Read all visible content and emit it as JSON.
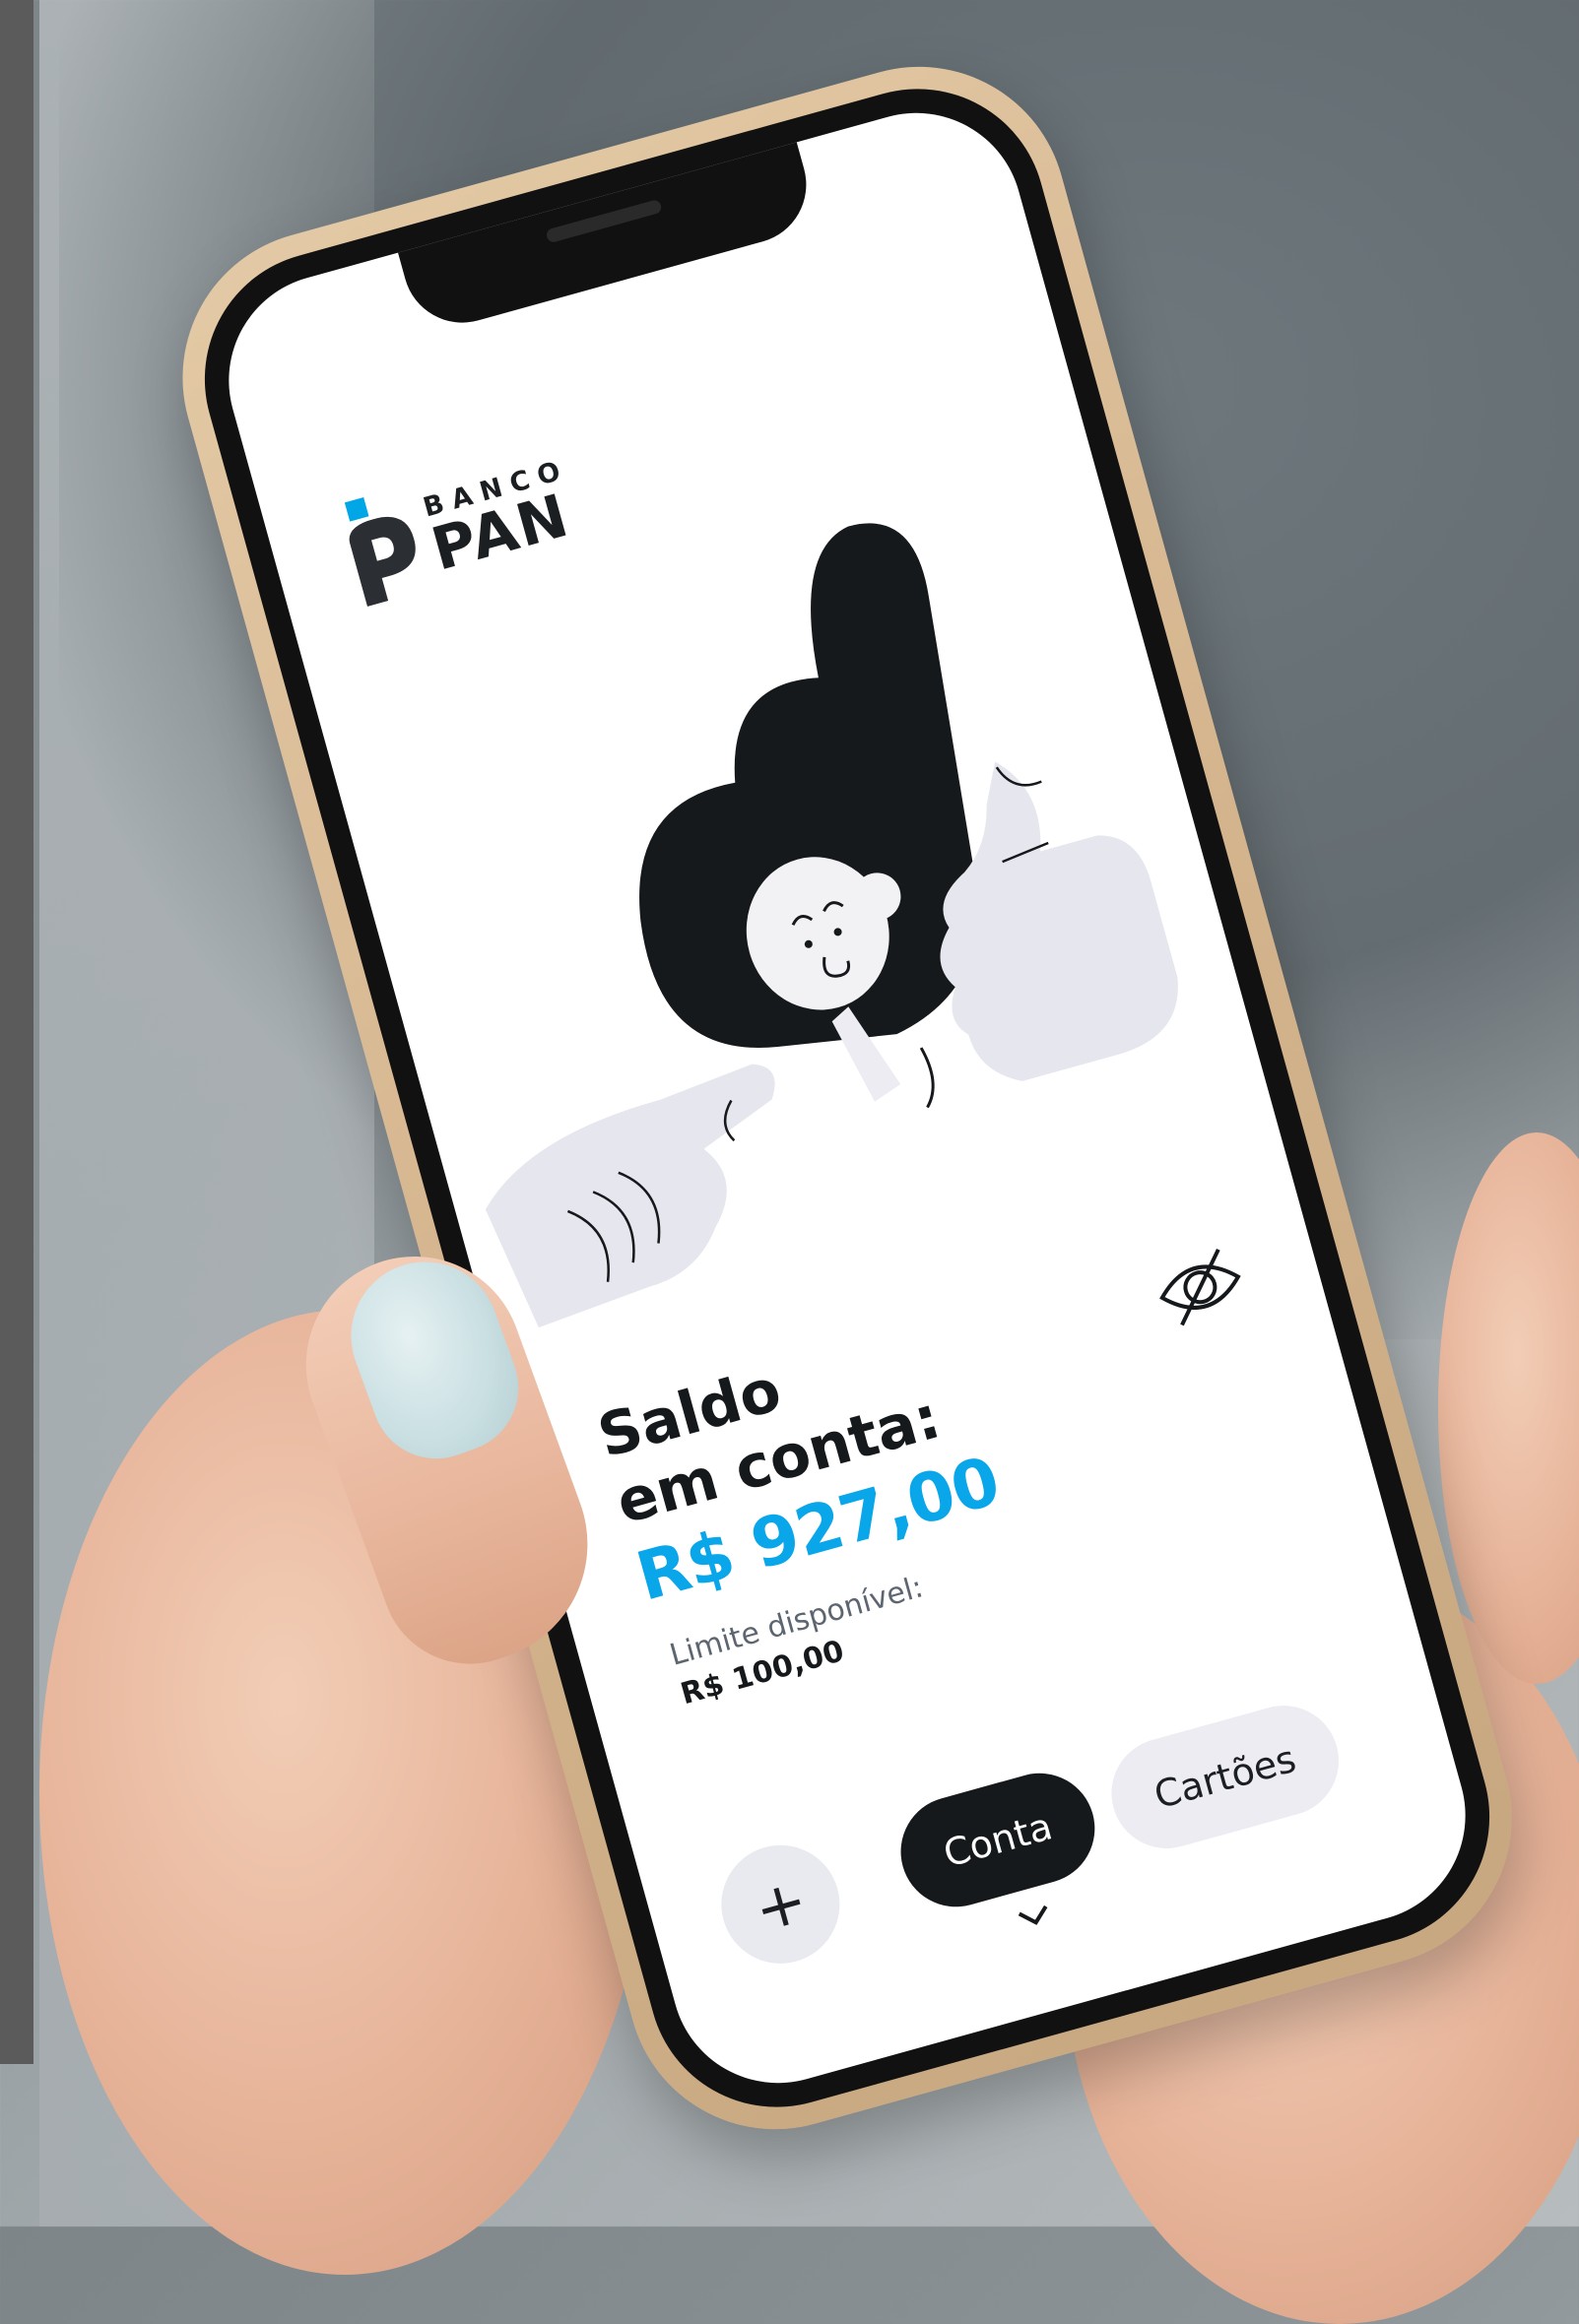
{
  "brand": {
    "line1": "BANCO",
    "line2": "PAN",
    "accent_color": "#00a6e6"
  },
  "balance": {
    "label": "Saldo\nem conta:",
    "value": "R$ 927,00",
    "value_color": "#0aa6ea",
    "visibility_icon": "eye-off-icon"
  },
  "limit": {
    "label": "Limite disponível:",
    "value": "R$ 100,00"
  },
  "bottom_nav": {
    "add_label": "+",
    "tabs": [
      {
        "label": "Conta",
        "active": true
      },
      {
        "label": "Cartões",
        "active": false
      }
    ],
    "chevron_icon": "chevron-down-icon"
  }
}
